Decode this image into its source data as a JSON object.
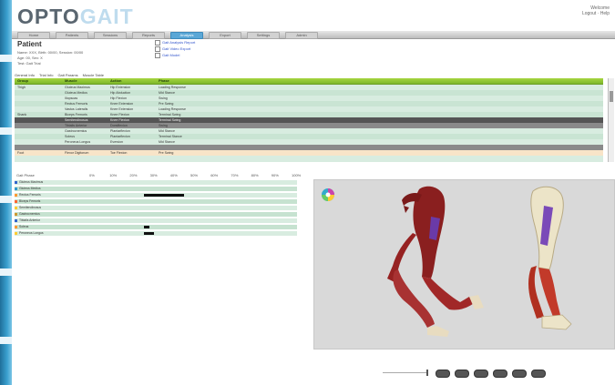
{
  "header": {
    "logo_main": "OPTO",
    "logo_accent": "GAIT",
    "user_line1": "Welcome",
    "user_line2": "Logout · Help"
  },
  "nav": {
    "items": [
      "Home",
      "Patients",
      "Sessions",
      "Reports",
      "Analysis",
      "Export",
      "Settings",
      "Admin"
    ],
    "active_index": 4
  },
  "patient": {
    "name": "Patient",
    "line1": "Name: XXX, Birth: 00/00, Session: 00/00",
    "line2": "Age: 00, Sex: X",
    "line3": "Test: Gait Trial"
  },
  "links": [
    "Gait Analysis Report",
    "Gait Video Export",
    "Gait Model"
  ],
  "subnav": [
    "General Info",
    "Trial Info",
    "Gait Params",
    "Muscle Table"
  ],
  "table": {
    "columns": [
      "Group",
      "Muscle",
      "Action",
      "Phase"
    ],
    "rows": [
      [
        "Thigh",
        "Gluteus Maximus",
        "Hip Extension",
        "Loading Response"
      ],
      [
        "",
        "Gluteus Medius",
        "Hip Abduction",
        "Mid Stance"
      ],
      [
        "",
        "Iliopsoas",
        "Hip Flexion",
        "Swing"
      ],
      [
        "",
        "Rectus Femoris",
        "Knee Extension",
        "Pre Swing"
      ],
      [
        "",
        "Vastus Lateralis",
        "Knee Extension",
        "Loading Response"
      ],
      [
        "Shank",
        "Biceps Femoris",
        "Knee Flexion",
        "Terminal Swing"
      ],
      [
        "",
        "Semitendinosus",
        "Knee Flexion",
        "Terminal Swing"
      ],
      [
        "",
        "Tibialis Anterior",
        "Dorsiflexion",
        "Swing"
      ],
      [
        "",
        "Gastrocnemius",
        "Plantarflexion",
        "Mid Stance"
      ],
      [
        "",
        "Soleus",
        "Plantarflexion",
        "Terminal Stance"
      ],
      [
        "",
        "Peroneus Longus",
        "Eversion",
        "Mid Stance"
      ],
      [
        "Foot",
        "Flexor Digitorum",
        "Toe Flexion",
        "Pre Swing"
      ]
    ]
  },
  "timeline": {
    "header": "Gait Phase",
    "ticks": [
      "0%",
      "10%",
      "20%",
      "30%",
      "40%",
      "50%",
      "60%",
      "70%",
      "80%",
      "90%",
      "100%"
    ],
    "rows": [
      {
        "label": "Gluteus Maximus",
        "color": "#3366cc",
        "bars": []
      },
      {
        "label": "Gluteus Medius",
        "color": "#3399cc",
        "bars": []
      },
      {
        "label": "Rectus Femoris",
        "color": "#ff9933",
        "bars": [
          [
            25,
            45
          ]
        ]
      },
      {
        "label": "Biceps Femoris",
        "color": "#ff6633",
        "bars": []
      },
      {
        "label": "Semitendinosus",
        "color": "#ffcc33",
        "bars": []
      },
      {
        "label": "Gastrocnemius",
        "color": "#cc9933",
        "bars": []
      },
      {
        "label": "Tibialis Anterior",
        "color": "#3366cc",
        "bars": []
      },
      {
        "label": "Soleus",
        "color": "#ff9933",
        "bars": [
          [
            25,
            28
          ]
        ]
      },
      {
        "label": "Peroneus Longus",
        "color": "#ffcc33",
        "bars": [
          [
            25,
            30
          ]
        ]
      }
    ]
  },
  "colors": {
    "accent": "#7cb82a",
    "nav_active": "#5aa7d6",
    "viewer_bg": "#d9d9d9"
  }
}
